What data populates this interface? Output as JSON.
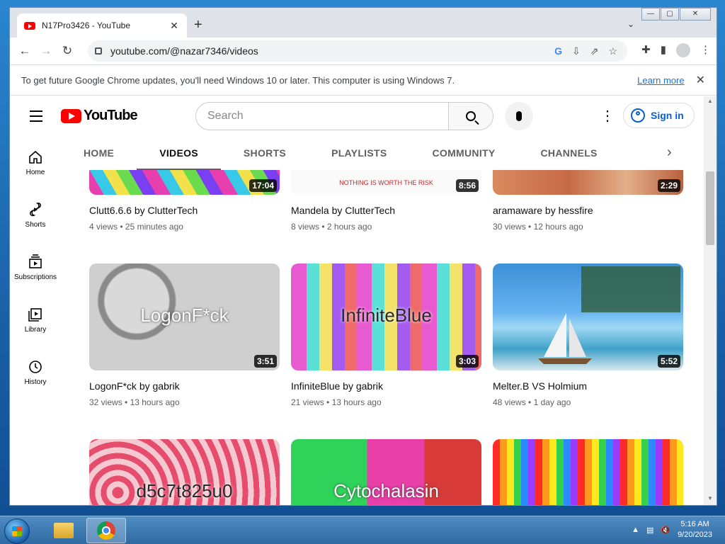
{
  "window": {
    "tab_title": "N17Pro3426 - YouTube",
    "url": "youtube.com/@nazar7346/videos",
    "controls": {
      "minimize": "—",
      "maximize": "▢",
      "close": "✕"
    }
  },
  "infobar": {
    "message": "To get future Google Chrome updates, you'll need Windows 10 or later. This computer is using Windows 7.",
    "link": "Learn more"
  },
  "youtube": {
    "logo_text": "YouTube",
    "search_placeholder": "Search",
    "sign_in": "Sign in",
    "sidebar": [
      {
        "label": "Home",
        "icon": "home-icon"
      },
      {
        "label": "Shorts",
        "icon": "shorts-icon"
      },
      {
        "label": "Subscriptions",
        "icon": "subscriptions-icon"
      },
      {
        "label": "Library",
        "icon": "library-icon"
      },
      {
        "label": "History",
        "icon": "history-icon"
      }
    ],
    "tabs": [
      "HOME",
      "VIDEOS",
      "SHORTS",
      "PLAYLISTS",
      "COMMUNITY",
      "CHANNELS"
    ],
    "active_tab": "VIDEOS",
    "videos": [
      {
        "title": "Clutt6.6.6 by ClutterTech",
        "views": "4 views",
        "age": "25 minutes ago",
        "duration": "17:04"
      },
      {
        "title": "Mandela by ClutterTech",
        "views": "8 views",
        "age": "2 hours ago",
        "duration": "8:56",
        "thumb_caption": "NOTHING IS WORTH THE RISK"
      },
      {
        "title": "aramaware by hessfire",
        "views": "30 views",
        "age": "12 hours ago",
        "duration": "2:29"
      },
      {
        "title": "LogonF*ck by gabrik",
        "views": "32 views",
        "age": "13 hours ago",
        "duration": "3:51",
        "thumb_text": "LogonF*ck"
      },
      {
        "title": "InfiniteBlue by gabrik",
        "views": "21 views",
        "age": "13 hours ago",
        "duration": "3:03",
        "thumb_text": "InfiniteBlue"
      },
      {
        "title": "Melter.B VS Holmium",
        "views": "48 views",
        "age": "1 day ago",
        "duration": "5:52"
      },
      {
        "thumb_text": "d5c7t825u0"
      },
      {
        "thumb_text": "Cytochalasin"
      },
      {
        "thumb_text": ""
      }
    ]
  },
  "taskbar": {
    "time": "5:16 AM",
    "date": "9/20/2023"
  }
}
